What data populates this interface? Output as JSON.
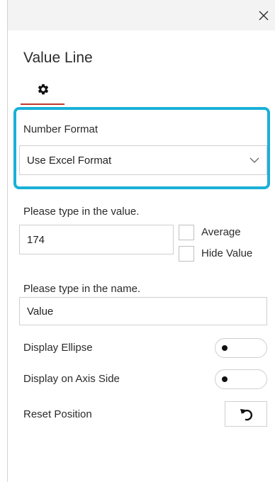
{
  "panel": {
    "title": "Value Line",
    "close_icon": "close-icon",
    "tab_icon": "gear-icon"
  },
  "number_format": {
    "label": "Number Format",
    "selected": "Use Excel Format",
    "highlight_color": "#1ab0d8"
  },
  "value_field": {
    "label": "Please type in the value.",
    "value": "174"
  },
  "checkboxes": {
    "average_label": "Average",
    "hide_value_label": "Hide Value"
  },
  "name_field": {
    "label": "Please type in the name.",
    "value": "Value"
  },
  "toggles": {
    "display_ellipse_label": "Display Ellipse",
    "display_axis_side_label": "Display on Axis Side"
  },
  "reset": {
    "label": "Reset Position",
    "icon": "undo-icon"
  }
}
